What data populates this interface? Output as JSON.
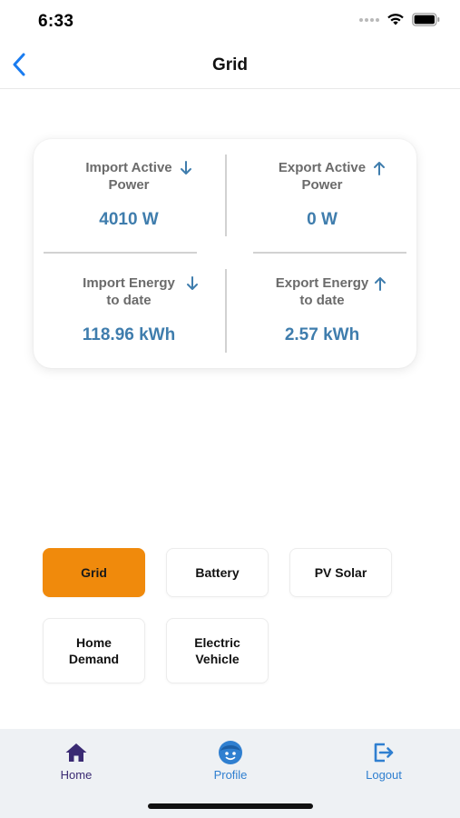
{
  "status_bar": {
    "time": "6:33"
  },
  "nav": {
    "title": "Grid"
  },
  "stats": {
    "import_power": {
      "label_line1": "Import Active",
      "label_line2": "Power",
      "value": "4010 W"
    },
    "export_power": {
      "label_line1": "Export Active",
      "label_line2": "Power",
      "value": "0 W"
    },
    "import_energy": {
      "label_line1": "Import Energy",
      "label_line2": "to date",
      "value": "118.96 kWh"
    },
    "export_energy": {
      "label_line1": "Export Energy",
      "label_line2": "to date",
      "value": "2.57 kWh"
    }
  },
  "categories": {
    "grid": "Grid",
    "battery": "Battery",
    "pv_solar": "PV Solar",
    "home_demand_line1": "Home",
    "home_demand_line2": "Demand",
    "ev_line1": "Electric",
    "ev_line2": "Vehicle",
    "selected": "Grid"
  },
  "tab_bar": {
    "home": "Home",
    "profile": "Profile",
    "logout": "Logout"
  },
  "colors": {
    "accent_orange": "#f08a0c",
    "value_blue": "#3f7dad",
    "arrow_blue": "#3f7dad",
    "home_purple": "#3a2a73",
    "tab_blue": "#2f7fd0",
    "back_blue": "#1a7cf0"
  },
  "icons": {
    "back": "chevron-left-icon",
    "import": "arrow-down-icon",
    "export": "arrow-up-icon",
    "home": "home-icon",
    "profile": "profile-face-icon",
    "logout": "logout-icon"
  }
}
